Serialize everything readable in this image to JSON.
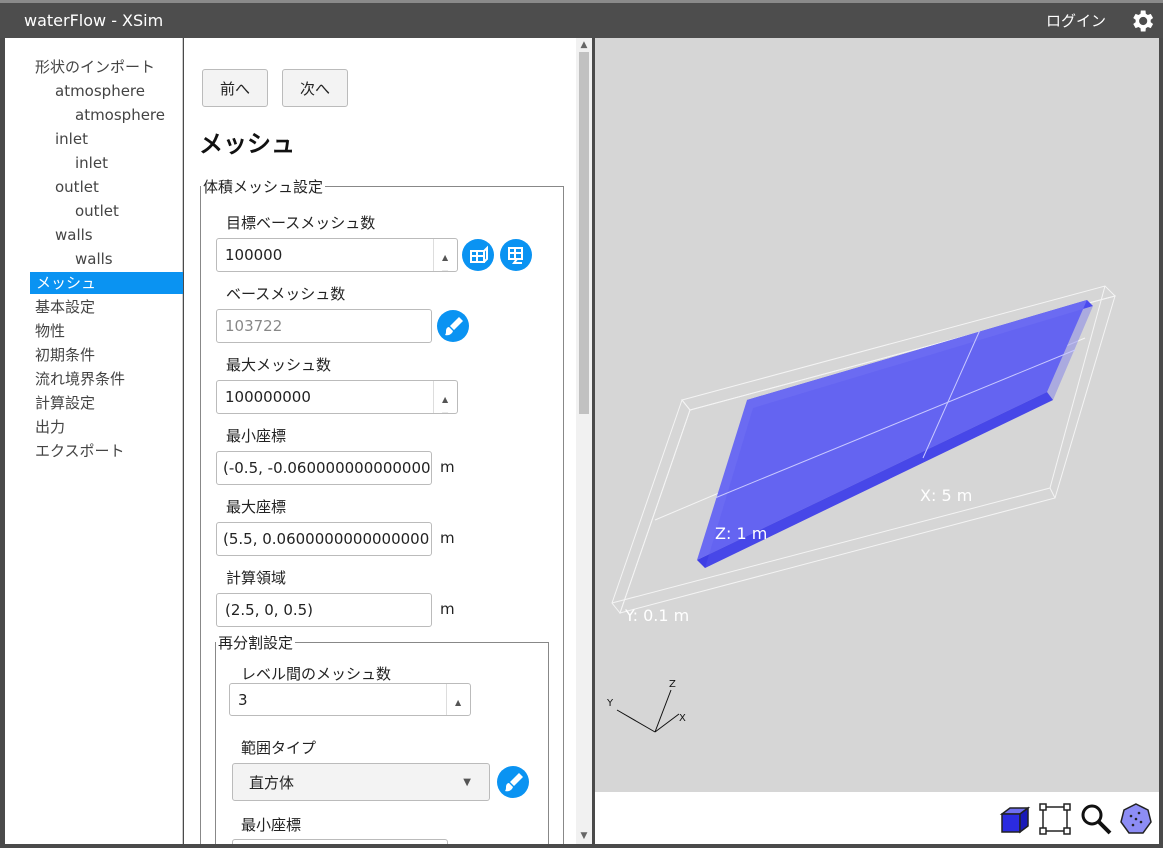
{
  "header": {
    "app_title": "waterFlow - XSim",
    "login_label": "ログイン",
    "settings_icon": "gear-icon"
  },
  "sidebar": {
    "items": [
      {
        "label": "形状のインポート"
      },
      {
        "label": "atmosphere"
      },
      {
        "label": "atmosphere"
      },
      {
        "label": "inlet"
      },
      {
        "label": "inlet"
      },
      {
        "label": "outlet"
      },
      {
        "label": "outlet"
      },
      {
        "label": "walls"
      },
      {
        "label": "walls"
      },
      {
        "label": "メッシュ"
      },
      {
        "label": "基本設定"
      },
      {
        "label": "物性"
      },
      {
        "label": "初期条件"
      },
      {
        "label": "流れ境界条件"
      },
      {
        "label": "計算設定"
      },
      {
        "label": "出力"
      },
      {
        "label": "エクスポート"
      }
    ],
    "active_label": "メッシュ"
  },
  "panel": {
    "prev_label": "前へ",
    "next_label": "次へ",
    "title": "メッシュ",
    "volume_mesh": {
      "legend": "体積メッシュ設定",
      "target_base_label": "目標ベースメッシュ数",
      "target_base_value": "100000",
      "base_mesh_label": "ベースメッシュ数",
      "base_mesh_value": "103722",
      "max_mesh_label": "最大メッシュ数",
      "max_mesh_value": "100000000",
      "min_coord_label": "最小座標",
      "min_coord_value": "(-0.5, -0.0600000000000000",
      "max_coord_label": "最大座標",
      "max_coord_value": "(5.5, 0.0600000000000000",
      "domain_label": "計算領域",
      "domain_value": "(2.5, 0, 0.5)",
      "unit": "m"
    },
    "refinement": {
      "legend": "再分割設定",
      "levels_label": "レベル間のメッシュ数",
      "levels_value": "3",
      "range_type_label": "範囲タイプ",
      "range_type_value": "直方体",
      "min_coord_label": "最小座標"
    }
  },
  "viewport": {
    "label_x": "X: 5 m",
    "label_y": "Y: 0.1 m",
    "label_z": "Z: 1 m",
    "axis_x": "X",
    "axis_y": "Y",
    "axis_z": "Z"
  },
  "colors": {
    "accent": "#0a93f2",
    "mesh_fill": "#5b5bf5",
    "viewport_bg": "#d6d6d6"
  }
}
